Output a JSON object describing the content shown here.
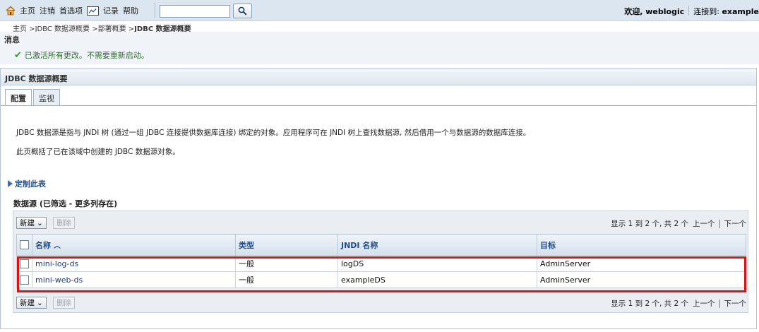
{
  "topbar": {
    "nav": [
      "主页",
      "注销",
      "首选项",
      "记录",
      "帮助"
    ],
    "search_placeholder": "",
    "welcome": "欢迎, weblogic",
    "connected_label": "连接到:",
    "connected_domain": "example"
  },
  "breadcrumb": {
    "items": [
      "主页",
      "JDBC 数据源概要",
      "部署概要"
    ],
    "current": "JDBC 数据源概要"
  },
  "messages": {
    "title": "消息",
    "text": "已激活所有更改。不需要重新启动。"
  },
  "panel": {
    "title": "JDBC 数据源概要",
    "tabs": [
      "配置",
      "监视"
    ],
    "description1": "JDBC 数据源是指与 JNDI 树 (通过一组 JDBC 连接提供数据库连接) 绑定的对象。应用程序可在 JNDI 树上查找数据源, 然后借用一个与数据源的数据库连接。",
    "description2": "此页概括了已在该域中创建的 JDBC 数据源对象。",
    "customize": "定制此表",
    "table_title": "数据源 (已筛选 - 更多列存在)",
    "new_button": "新建",
    "delete_button": "删除",
    "pager_info": "显示 1 到 2 个, 共 2 个",
    "prev": "上一个",
    "next": "下一个",
    "columns": [
      "名称",
      "类型",
      "JNDI 名称",
      "目标"
    ],
    "rows": [
      {
        "name": "mini-log-ds",
        "type": "一般",
        "jndi": "logDS",
        "target": "AdminServer"
      },
      {
        "name": "mini-web-ds",
        "type": "一般",
        "jndi": "exampleDS",
        "target": "AdminServer"
      }
    ]
  },
  "colors": {
    "toolbar_bg": "#dbe6f1",
    "link": "#1f3f7a",
    "highlight": "#e01010",
    "success": "#2e9a2e"
  },
  "icons": [
    "home-icon",
    "record-icon",
    "search-icon",
    "check-icon",
    "expand-triangle-icon",
    "sort-ascending-icon",
    "dropdown-arrow-icon"
  ]
}
